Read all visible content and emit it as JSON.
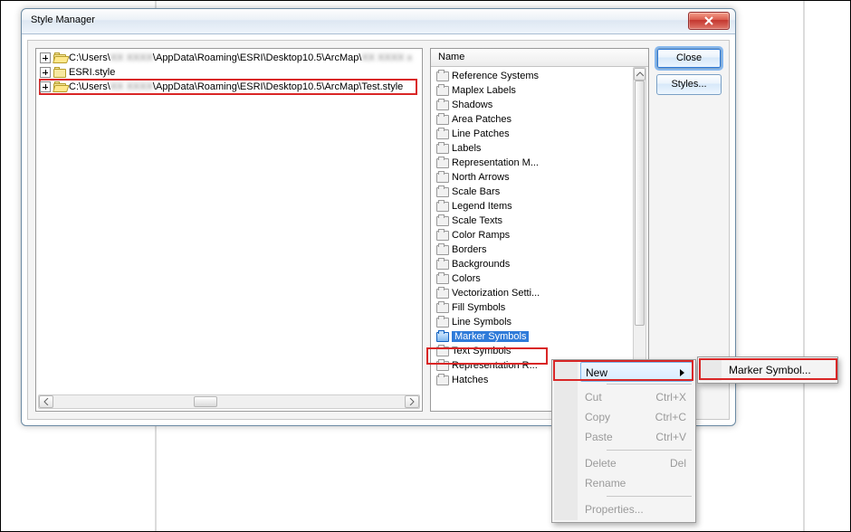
{
  "window": {
    "title": "Style Manager"
  },
  "buttons": {
    "close": "Close",
    "styles": "Styles..."
  },
  "tree": [
    {
      "open": true,
      "pre": "C:\\Users\\",
      "blur": "XX XXXX",
      "post": "\\AppData\\Roaming\\ESRI\\Desktop10.5\\ArcMap\\",
      "blur2": "XX XXXX x"
    },
    {
      "open": false,
      "pre": "ESRI.style",
      "blur": "",
      "post": "",
      "blur2": ""
    },
    {
      "open": true,
      "pre": "C:\\Users\\",
      "blur": "XX XXXX",
      "post": "\\AppData\\Roaming\\ESRI\\Desktop10.5\\ArcMap\\Test.style",
      "blur2": "",
      "highlighted": true
    }
  ],
  "list_header": "Name",
  "list_items": [
    "Reference Systems",
    "Maplex Labels",
    "Shadows",
    "Area Patches",
    "Line Patches",
    "Labels",
    "Representation M...",
    "North Arrows",
    "Scale Bars",
    "Legend Items",
    "Scale Texts",
    "Color Ramps",
    "Borders",
    "Backgrounds",
    "Colors",
    "Vectorization Setti...",
    "Fill Symbols",
    "Line Symbols",
    "Marker Symbols",
    "Text Symbols",
    "Representation R...",
    "Hatches"
  ],
  "list_selected_index": 18,
  "context_menu": {
    "items": [
      {
        "label": "New",
        "hasSubmenu": true,
        "selected": true
      },
      {
        "sep": true
      },
      {
        "label": "Cut",
        "shortcut": "Ctrl+X",
        "disabled": true
      },
      {
        "label": "Copy",
        "shortcut": "Ctrl+C",
        "disabled": true
      },
      {
        "label": "Paste",
        "shortcut": "Ctrl+V",
        "disabled": true
      },
      {
        "sep": true
      },
      {
        "label": "Delete",
        "shortcut": "Del",
        "disabled": true
      },
      {
        "label": "Rename",
        "disabled": true
      },
      {
        "sep": true
      },
      {
        "label": "Properties...",
        "disabled": true
      }
    ]
  },
  "submenu": {
    "items": [
      {
        "label": "Marker Symbol..."
      }
    ]
  }
}
